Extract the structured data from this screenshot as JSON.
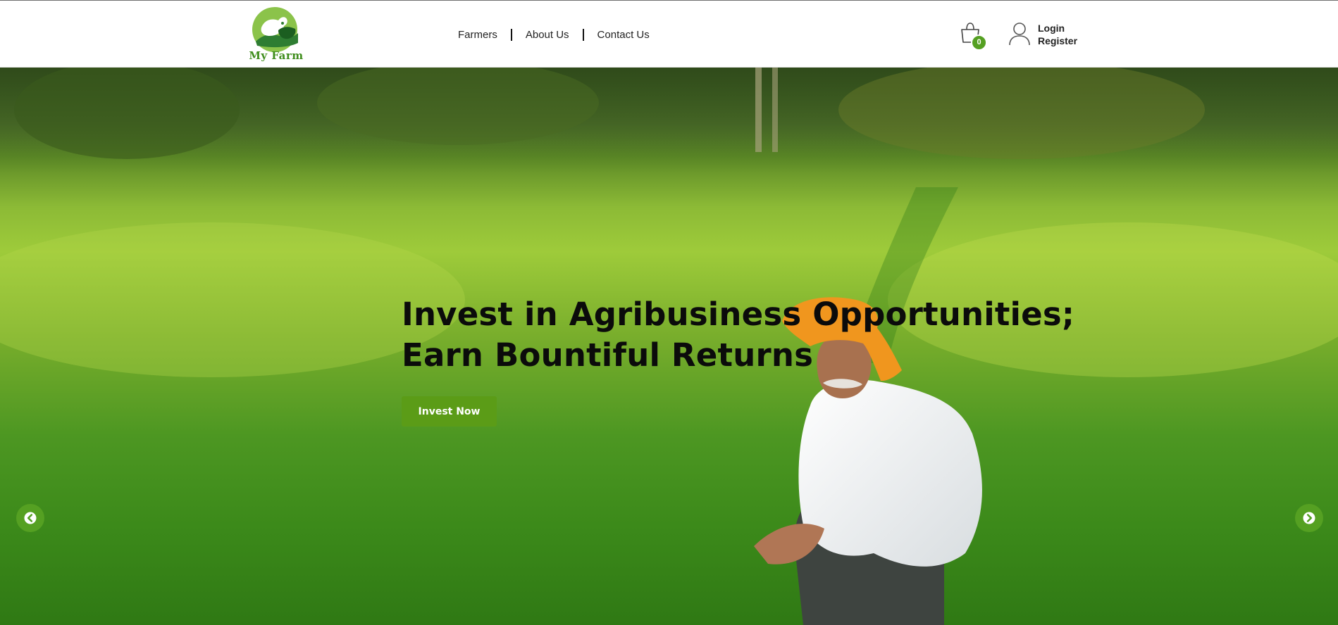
{
  "brand": {
    "name": "My Farm",
    "logo_icon": "farm-animals-icon"
  },
  "nav": {
    "items": [
      {
        "label": "Farmers"
      },
      {
        "label": "About Us"
      },
      {
        "label": "Contact Us"
      }
    ]
  },
  "cart": {
    "icon": "shopping-bag-icon",
    "count": "0"
  },
  "account": {
    "icon": "user-icon",
    "login_label": "Login",
    "register_label": "Register"
  },
  "hero": {
    "headline_line1": "Invest in Agribusiness Opportunities;",
    "headline_line2": "Earn Bountiful Returns",
    "cta_label": "Invest Now",
    "prev_icon": "chevron-left-circle-icon",
    "next_icon": "chevron-right-circle-icon"
  },
  "colors": {
    "accent": "#55a022",
    "button": "#5b9c17",
    "text": "#0b0b0b",
    "header_bg": "#ffffff"
  }
}
